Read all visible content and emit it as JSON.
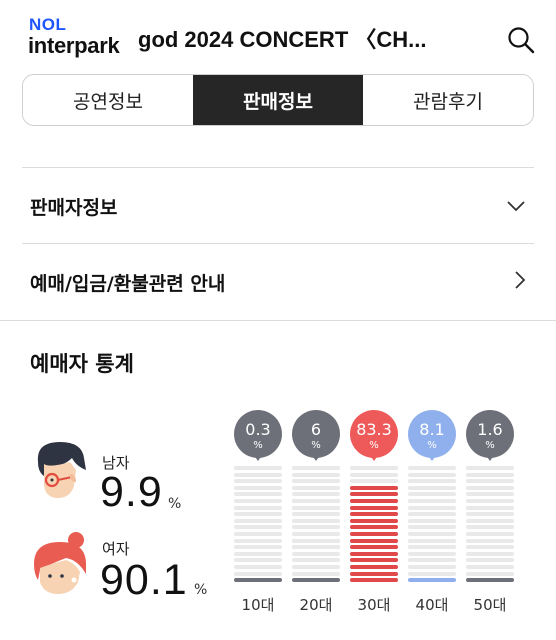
{
  "header": {
    "logo_top": "NOL",
    "logo_bottom": "interpark",
    "title": "god 2024 CONCERT 〈CH..."
  },
  "tabs": [
    {
      "label": "공연정보",
      "active": false
    },
    {
      "label": "판매정보",
      "active": true
    },
    {
      "label": "관람후기",
      "active": false
    }
  ],
  "sections": {
    "seller_info": "판매자정보",
    "booking_guide": "예매/입금/환불관련 안내"
  },
  "stats": {
    "title": "예매자 통계",
    "male": {
      "label": "남자",
      "value": "9.9",
      "unit": "%"
    },
    "female": {
      "label": "여자",
      "value": "90.1",
      "unit": "%"
    },
    "ages": [
      {
        "label": "10대",
        "value": "0.3",
        "pct_sign": "%",
        "percent": 0.3,
        "color": "#6e7079",
        "bar_color": "#6e7079"
      },
      {
        "label": "20대",
        "value": "6",
        "pct_sign": "%",
        "percent": 6,
        "color": "#6e7079",
        "bar_color": "#6e7079"
      },
      {
        "label": "30대",
        "value": "83.3",
        "pct_sign": "%",
        "percent": 83.3,
        "color": "#ee5a5a",
        "bar_color": "#e0484a"
      },
      {
        "label": "40대",
        "value": "8.1",
        "pct_sign": "%",
        "percent": 8.1,
        "color": "#8fb0ec",
        "bar_color": "#8fb0ec"
      },
      {
        "label": "50대",
        "value": "1.6",
        "pct_sign": "%",
        "percent": 1.6,
        "color": "#6e7079",
        "bar_color": "#6e7079"
      }
    ]
  },
  "icons": {
    "search": "search-icon",
    "chevron_down": "chevron-down-icon",
    "chevron_right": "chevron-right-icon"
  },
  "colors": {
    "brand_blue": "#1f55ff",
    "tab_active_bg": "#262626",
    "highlight_red": "#ee5a5a",
    "highlight_blue": "#8fb0ec"
  }
}
